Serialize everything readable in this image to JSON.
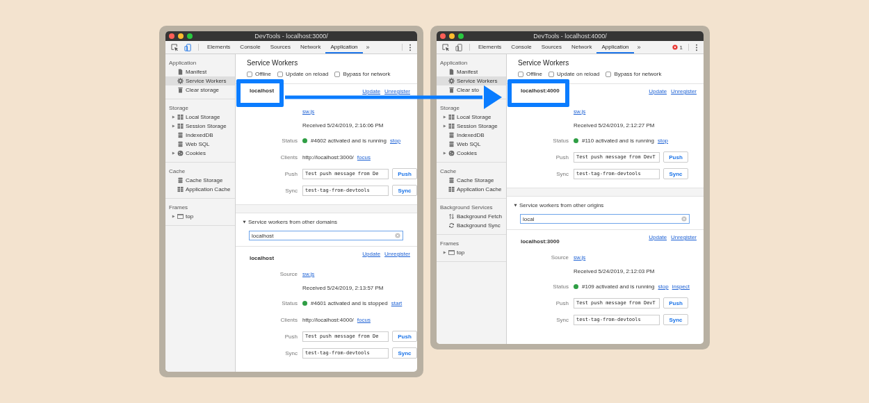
{
  "annotation_arrow": true,
  "windows": [
    {
      "title": "DevTools - localhost:3000/",
      "device_mode": true,
      "overflow": "»",
      "tabs": [
        {
          "label": "Elements",
          "selected": false
        },
        {
          "label": "Console",
          "selected": false
        },
        {
          "label": "Sources",
          "selected": false
        },
        {
          "label": "Network",
          "selected": false
        },
        {
          "label": "Application",
          "selected": true
        }
      ],
      "sidebar": [
        {
          "title": "Application",
          "items": [
            {
              "label": "Manifest",
              "kind": "file",
              "expandable": false,
              "selected": false
            },
            {
              "label": "Service Workers",
              "kind": "gear",
              "expandable": false,
              "selected": true
            },
            {
              "label": "Clear storage",
              "kind": "trash",
              "expandable": false,
              "selected": false
            }
          ]
        },
        {
          "title": "Storage",
          "items": [
            {
              "label": "Local Storage",
              "kind": "grid",
              "expandable": true,
              "selected": false
            },
            {
              "label": "Session Storage",
              "kind": "grid",
              "expandable": true,
              "selected": false
            },
            {
              "label": "IndexedDB",
              "kind": "db",
              "expandable": false,
              "selected": false
            },
            {
              "label": "Web SQL",
              "kind": "db",
              "expandable": false,
              "selected": false
            },
            {
              "label": "Cookies",
              "kind": "cookie",
              "expandable": true,
              "selected": false
            }
          ]
        },
        {
          "title": "Cache",
          "items": [
            {
              "label": "Cache Storage",
              "kind": "db",
              "expandable": false,
              "selected": false
            },
            {
              "label": "Application Cache",
              "kind": "grid",
              "expandable": false,
              "selected": false
            }
          ]
        },
        {
          "title": "Frames",
          "items": [
            {
              "label": "top",
              "kind": "frame",
              "expandable": true,
              "selected": false
            }
          ]
        }
      ],
      "main": {
        "heading": "Service Workers",
        "options": [
          {
            "label": "Offline",
            "checked": false
          },
          {
            "label": "Update on reload",
            "checked": false
          },
          {
            "label": "Bypass for network",
            "checked": false
          }
        ],
        "workers": [
          {
            "origin": "localhost",
            "highlighted": true,
            "actions": [
              "Update",
              "Unregister"
            ],
            "rows": [
              {
                "kind": "source",
                "link": "sw.js"
              },
              {
                "kind": "received",
                "text": "Received 5/24/2019, 2:16:06 PM"
              },
              {
                "kind": "status",
                "label": "Status",
                "text": "#4602 activated and is running",
                "links": [
                  "stop"
                ]
              },
              {
                "kind": "clients",
                "label": "Clients",
                "text": "http://localhost:3000/",
                "links": [
                  "focus"
                ]
              },
              {
                "kind": "push",
                "label": "Push",
                "value": "Test push message from De",
                "button": "Push"
              },
              {
                "kind": "sync",
                "label": "Sync",
                "value": "test-tag-from-devtools",
                "button": "Sync"
              }
            ]
          }
        ],
        "other": {
          "title": "Service workers from other domains",
          "expanded": true,
          "filter": "localhost",
          "workers": [
            {
              "origin": "localhost",
              "highlighted": false,
              "actions": [
                "Update",
                "Unregister"
              ],
              "rows": [
                {
                  "kind": "source",
                  "label": "Source",
                  "link": "sw.js"
                },
                {
                  "kind": "received",
                  "text": "Received 5/24/2019, 2:13:57 PM"
                },
                {
                  "kind": "status",
                  "label": "Status",
                  "text": "#4601 activated and is stopped",
                  "links": [
                    "start"
                  ]
                },
                {
                  "kind": "clients",
                  "label": "Clients",
                  "text": "http://localhost:4000/",
                  "links": [
                    "focus"
                  ]
                },
                {
                  "kind": "push",
                  "label": "Push",
                  "value": "Test push message from De",
                  "button": "Push"
                },
                {
                  "kind": "sync",
                  "label": "Sync",
                  "value": "test-tag-from-devtools",
                  "button": "Sync"
                }
              ]
            }
          ]
        }
      }
    },
    {
      "title": "DevTools - localhost:4000/",
      "device_mode": false,
      "overflow": "»",
      "errors": "1",
      "tabs": [
        {
          "label": "Elements",
          "selected": false
        },
        {
          "label": "Console",
          "selected": false
        },
        {
          "label": "Sources",
          "selected": false
        },
        {
          "label": "Network",
          "selected": false
        },
        {
          "label": "Application",
          "selected": true
        }
      ],
      "sidebar": [
        {
          "title": "Application",
          "items": [
            {
              "label": "Manifest",
              "kind": "file",
              "expandable": false,
              "selected": false
            },
            {
              "label": "Service Workers",
              "kind": "gear",
              "expandable": false,
              "selected": true
            },
            {
              "label": "Clear sto",
              "kind": "trash",
              "expandable": false,
              "selected": false
            }
          ]
        },
        {
          "title": "Storage",
          "items": [
            {
              "label": "Local Storage",
              "kind": "grid",
              "expandable": true,
              "selected": false
            },
            {
              "label": "Session Storage",
              "kind": "grid",
              "expandable": true,
              "selected": false
            },
            {
              "label": "IndexedDB",
              "kind": "db",
              "expandable": false,
              "selected": false
            },
            {
              "label": "Web SQL",
              "kind": "db",
              "expandable": false,
              "selected": false
            },
            {
              "label": "Cookies",
              "kind": "cookie",
              "expandable": true,
              "selected": false
            }
          ]
        },
        {
          "title": "Cache",
          "items": [
            {
              "label": "Cache Storage",
              "kind": "db",
              "expandable": false,
              "selected": false
            },
            {
              "label": "Application Cache",
              "kind": "grid",
              "expandable": false,
              "selected": false
            }
          ]
        },
        {
          "title": "Background Services",
          "items": [
            {
              "label": "Background Fetch",
              "kind": "fetch",
              "expandable": false,
              "selected": false
            },
            {
              "label": "Background Sync",
              "kind": "sync",
              "expandable": false,
              "selected": false
            }
          ]
        },
        {
          "title": "Frames",
          "items": [
            {
              "label": "top",
              "kind": "frame",
              "expandable": true,
              "selected": false
            }
          ]
        }
      ],
      "main": {
        "heading": "Service Workers",
        "options": [
          {
            "label": "Offline",
            "checked": false
          },
          {
            "label": "Update on reload",
            "checked": false
          },
          {
            "label": "Bypass for network",
            "checked": false
          }
        ],
        "workers": [
          {
            "origin": "localhost:4000",
            "highlighted": true,
            "actions": [
              "Update",
              "Unregister"
            ],
            "rows": [
              {
                "kind": "source",
                "link": "sw.js"
              },
              {
                "kind": "received",
                "text": "Received 5/24/2019, 2:12:27 PM"
              },
              {
                "kind": "status",
                "label": "Status",
                "text": "#110 activated and is running",
                "links": [
                  "stop"
                ]
              },
              {
                "kind": "push",
                "label": "Push",
                "value": "Test push message from DevT",
                "button": "Push"
              },
              {
                "kind": "sync",
                "label": "Sync",
                "value": "test-tag-from-devtools",
                "button": "Sync"
              }
            ]
          }
        ],
        "other": {
          "title": "Service workers from other origins",
          "expanded": true,
          "filter": "local",
          "workers": [
            {
              "origin": "localhost:3000",
              "highlighted": false,
              "actions": [
                "Update",
                "Unregister"
              ],
              "rows": [
                {
                  "kind": "source",
                  "label": "Source",
                  "link": "sw.js"
                },
                {
                  "kind": "received",
                  "text": "Received 5/24/2019, 2:12:03 PM"
                },
                {
                  "kind": "status",
                  "label": "Status",
                  "text": "#109 activated and is running",
                  "links": [
                    "stop",
                    "inspect"
                  ]
                },
                {
                  "kind": "push",
                  "label": "Push",
                  "value": "Test push message from DevT",
                  "button": "Push"
                },
                {
                  "kind": "sync",
                  "label": "Sync",
                  "value": "test-tag-from-devtools",
                  "button": "Sync"
                }
              ]
            }
          ]
        }
      }
    }
  ]
}
